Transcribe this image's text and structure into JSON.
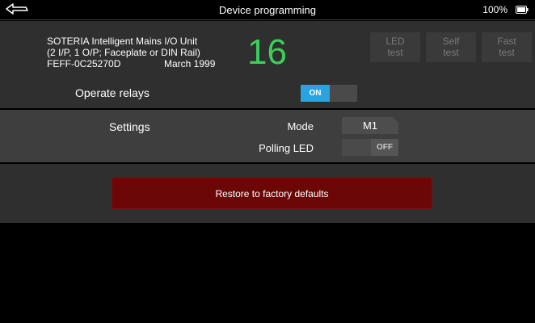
{
  "statusbar": {
    "title": "Device programming",
    "battery": "100%",
    "back_icon": "back-arrow-icon",
    "battery_icon": "battery-icon"
  },
  "device": {
    "name": "SOTERIA Intelligent Mains I/O Unit",
    "description": "(2 I/P, 1 O/P; Faceplate or DIN Rail)",
    "serial": "FEFF-0C25270D",
    "date": "March 1999",
    "address": "16"
  },
  "test_buttons": [
    {
      "line1": "LED",
      "line2": "test"
    },
    {
      "line1": "Self",
      "line2": "test"
    },
    {
      "line1": "Fast",
      "line2": "test"
    }
  ],
  "relays": {
    "label": "Operate relays",
    "state": "ON"
  },
  "settings": {
    "label": "Settings",
    "mode_label": "Mode",
    "mode_value": "M1",
    "polling_label": "Polling LED",
    "polling_state": "OFF"
  },
  "restore": {
    "label": "Restore to factory defaults"
  },
  "colors": {
    "address_green": "#3ccf5a",
    "toggle_on": "#2aa3de",
    "restore_red": "#6b0707"
  }
}
